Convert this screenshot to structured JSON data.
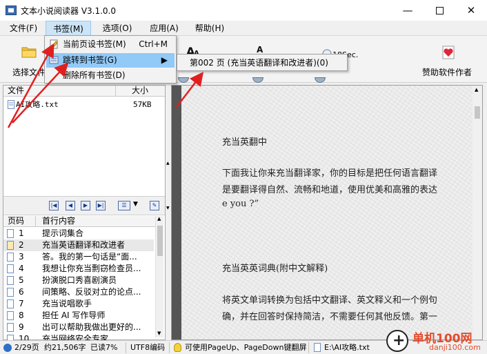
{
  "window": {
    "title": "文本小说阅读器 V3.1.0.0"
  },
  "menu": {
    "items": [
      "文件(F)",
      "书签(M)",
      "选项(O)",
      "应用(A)",
      "帮助(H)"
    ],
    "active": "书签(M)"
  },
  "bookmark_menu": {
    "items": [
      {
        "label": "当前页设书签(M)",
        "shortcut": "Ctrl+M"
      },
      {
        "label": "跳转到书签(G)"
      },
      {
        "label": "删除所有书签(D)"
      }
    ],
    "submenu": {
      "label": "第002 页 (充当英语翻译和改进者)(0)"
    }
  },
  "toolbar": {
    "open_label": "选择文件",
    "timer_text": "18Sec.",
    "donate_label": "赞助软件作者"
  },
  "file_list": {
    "headers": [
      "文件",
      "大小"
    ],
    "rows": [
      {
        "name": "AI攻略.txt",
        "size": "57KB"
      }
    ]
  },
  "chapter_list": {
    "headers": [
      "页码",
      "首行内容"
    ],
    "rows": [
      {
        "page": "1",
        "title": "提示词集合"
      },
      {
        "page": "2",
        "title": "充当英语翻译和改进者",
        "bookmarked": true
      },
      {
        "page": "3",
        "title": "答。我的第一句话是“面..."
      },
      {
        "page": "4",
        "title": "我想让你充当剽窃检查员..."
      },
      {
        "page": "5",
        "title": "扮演脱口秀喜剧演员"
      },
      {
        "page": "6",
        "title": "间策略、反驳对立的论点..."
      },
      {
        "page": "7",
        "title": "充当说唱歌手"
      },
      {
        "page": "8",
        "title": "担任 AI 写作导师"
      },
      {
        "page": "9",
        "title": "出可以帮助我做出更好的..."
      },
      {
        "page": "10",
        "title": "充当网络安全专家"
      }
    ]
  },
  "reader": {
    "lines": [
      "充当英翻中",
      "下面我让你来充当翻译家，你的目标是把任何语言翻译",
      "是要翻译得自然、流畅和地道，使用优美和高雅的表达",
      "e you ?”",
      "充当英英词典(附中文解释)",
      "将英文单词转换为包括中文翻译、英文释义和一个例句",
      "确，并在回答时保持简洁，不需要任何其他反馈。第一"
    ]
  },
  "status": {
    "page": "2/29页",
    "chars": "约21,506字",
    "progress": "已读7%",
    "encoding": "UTF8编码",
    "hint": "可使用PageUp、PageDown键翻屏",
    "path": "E:\\AI攻略.txt"
  },
  "watermark": {
    "line1": "单机100网",
    "line2": "danji100.com"
  },
  "colors": {
    "menu_highlight": "#91c9f7",
    "arrow": "#e02020",
    "watermark": "#e34b2b"
  }
}
